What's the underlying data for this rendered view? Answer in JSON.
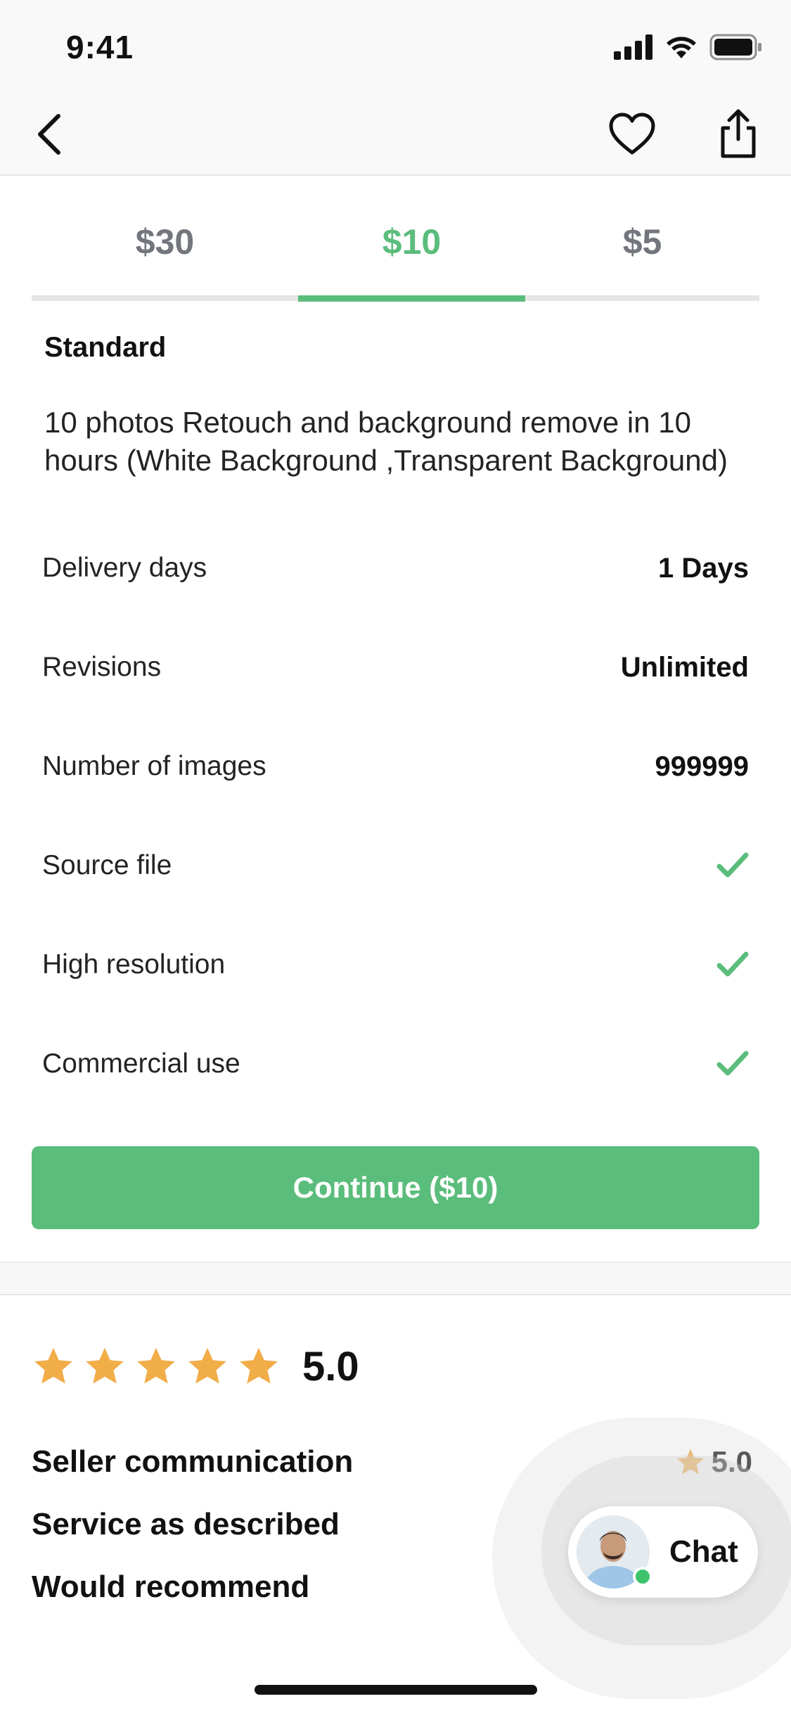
{
  "status_bar": {
    "time": "9:41"
  },
  "tabs": [
    {
      "label": "$30",
      "active": false
    },
    {
      "label": "$10",
      "active": true
    },
    {
      "label": "$5",
      "active": false
    }
  ],
  "package": {
    "title": "Standard",
    "description": "10 photos Retouch and background remove in 10 hours (White  Background ,Transparent Background)"
  },
  "features": {
    "delivery": {
      "label": "Delivery days",
      "value": "1 Days"
    },
    "revisions": {
      "label": "Revisions",
      "value": "Unlimited"
    },
    "images": {
      "label": "Number of images",
      "value": "999999"
    },
    "source_file": {
      "label": "Source file",
      "included": true
    },
    "high_resolution": {
      "label": "High resolution",
      "included": true
    },
    "commercial_use": {
      "label": "Commercial use",
      "included": true
    }
  },
  "continue_label": "Continue ($10)",
  "rating": {
    "value": "5.0",
    "stars": 5,
    "breakdown": {
      "seller_communication": {
        "label": "Seller communication",
        "score": "5.0"
      },
      "service_as_described": {
        "label": "Service as described"
      },
      "would_recommend": {
        "label": "Would recommend"
      }
    }
  },
  "chat": {
    "label": "Chat"
  },
  "colors": {
    "accent": "#5bbd7b",
    "star": "#f1ad48",
    "text": "#222325",
    "muted": "#74767e"
  },
  "icons": [
    "back-chevron-icon",
    "heart-icon",
    "share-icon",
    "checkmark-icon",
    "star-icon",
    "cellular-signal-icon",
    "wifi-icon",
    "battery-icon"
  ]
}
